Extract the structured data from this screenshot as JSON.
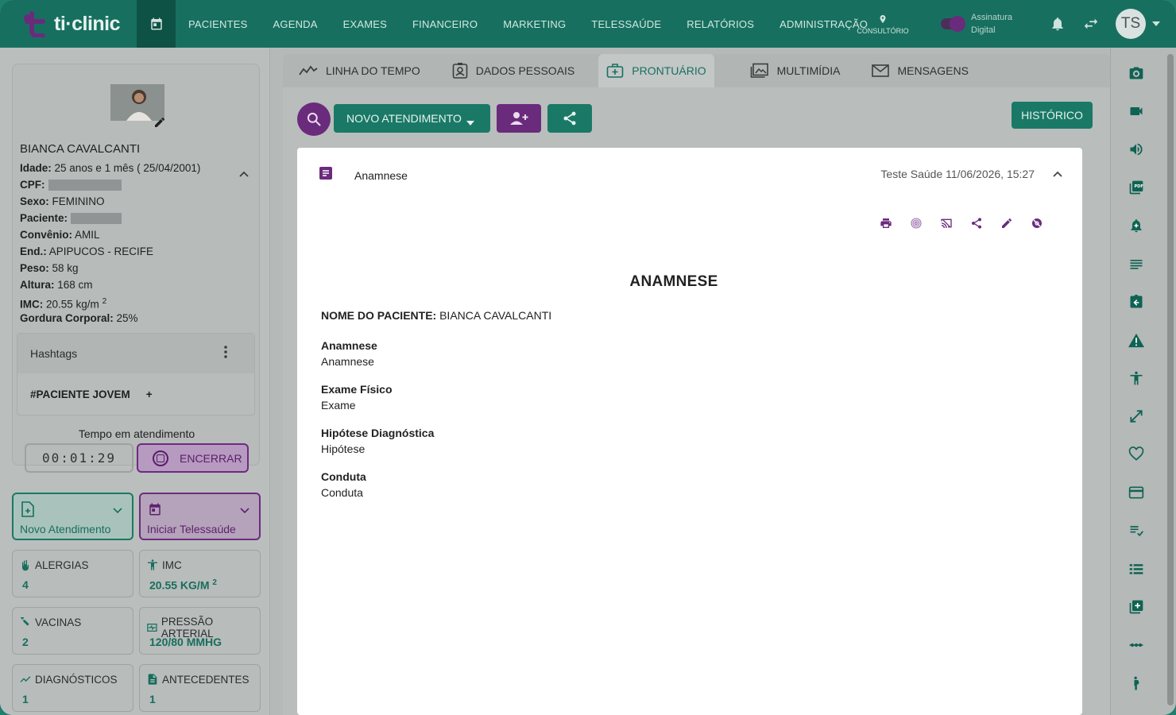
{
  "brand": {
    "name": "ti·clinic"
  },
  "topnav": {
    "items": [
      "PACIENTES",
      "AGENDA",
      "EXAMES",
      "FINANCEIRO",
      "MARKETING",
      "TELESSAÚDE",
      "RELATÓRIOS",
      "ADMINISTRAÇÃO"
    ],
    "location_label": "CONSULTÓRIO",
    "signature_label_1": "Assinatura",
    "signature_label_2": "Digital",
    "user_initials": "TS"
  },
  "patient": {
    "name": "BIANCA CAVALCANTI",
    "fields": [
      {
        "label": "Idade:",
        "value": "25 anos e 1 mês ( 25/04/2001)"
      },
      {
        "label": "CPF:",
        "value": ""
      },
      {
        "label": "Sexo:",
        "value": "FEMININO"
      },
      {
        "label": "Paciente:",
        "value": ""
      },
      {
        "label": "Convênio:",
        "value": "AMIL"
      },
      {
        "label": "End.:",
        "value": "APIPUCOS -  RECIFE"
      },
      {
        "label": "Peso:",
        "value": "58 kg"
      },
      {
        "label": "Altura:",
        "value": "168 cm"
      },
      {
        "label": "IMC:",
        "value": "20.55 kg/m",
        "sup": "2"
      },
      {
        "label": "Gordura Corporal:",
        "value": "25%"
      }
    ],
    "hashtags_title": "Hashtags",
    "hashtag": "#PACIENTE JOVEM",
    "hashtag_add": "+"
  },
  "session": {
    "label": "Tempo em atendimento",
    "timer": "00:01:29",
    "end_button": "ENCERRAR"
  },
  "quick_actions": {
    "new_visit": "Novo Atendimento",
    "telehealth": "Iniciar Telessaúde"
  },
  "stats": [
    {
      "title": "ALERGIAS",
      "value": "4"
    },
    {
      "title": "IMC",
      "value": "20.55 KG/M",
      "sup": "2"
    },
    {
      "title": "VACINAS",
      "value": "2"
    },
    {
      "title": "PRESSÃO ARTERIAL",
      "value": "120/80 MMHG"
    },
    {
      "title": "DIAGNÓSTICOS",
      "value": "1"
    },
    {
      "title": "ANTECEDENTES",
      "value": "1"
    }
  ],
  "tabs": [
    "LINHA DO TEMPO",
    "DADOS PESSOAIS",
    "PRONTUÁRIO",
    "MULTIMÍDIA",
    "MENSAGENS"
  ],
  "active_tab": "PRONTUÁRIO",
  "toolbar": {
    "new_visit_button": "NOVO ATENDIMENTO",
    "history_button": "HISTÓRICO"
  },
  "record": {
    "type": "Anamnese",
    "meta": "Teste Saúde 11/06/2026, 15:27",
    "doc_title": "ANAMNESE",
    "patient_label": "NOME DO PACIENTE:",
    "patient_value": "BIANCA CAVALCANTI",
    "sections": [
      {
        "title": "Anamnese",
        "value": "Anamnese"
      },
      {
        "title": "Exame Físico",
        "value": "Exame"
      },
      {
        "title": "Hipótese Diagnóstica",
        "value": "Hipótese"
      },
      {
        "title": "Conduta",
        "value": "Conduta"
      }
    ]
  },
  "rail_icons": [
    "camera-icon",
    "video-icon",
    "audio-icon",
    "pdf-icon",
    "alarm-add-icon",
    "list-icon",
    "clipboard-icon",
    "warning-icon",
    "body-icon",
    "expand-icon",
    "heart-icon",
    "card-icon",
    "checklist-icon",
    "list-bullet-icon",
    "add-box-icon",
    "dots-line-icon",
    "pregnant-icon"
  ],
  "colors": {
    "primary": "#17705f",
    "accent": "#6a2b7c"
  }
}
